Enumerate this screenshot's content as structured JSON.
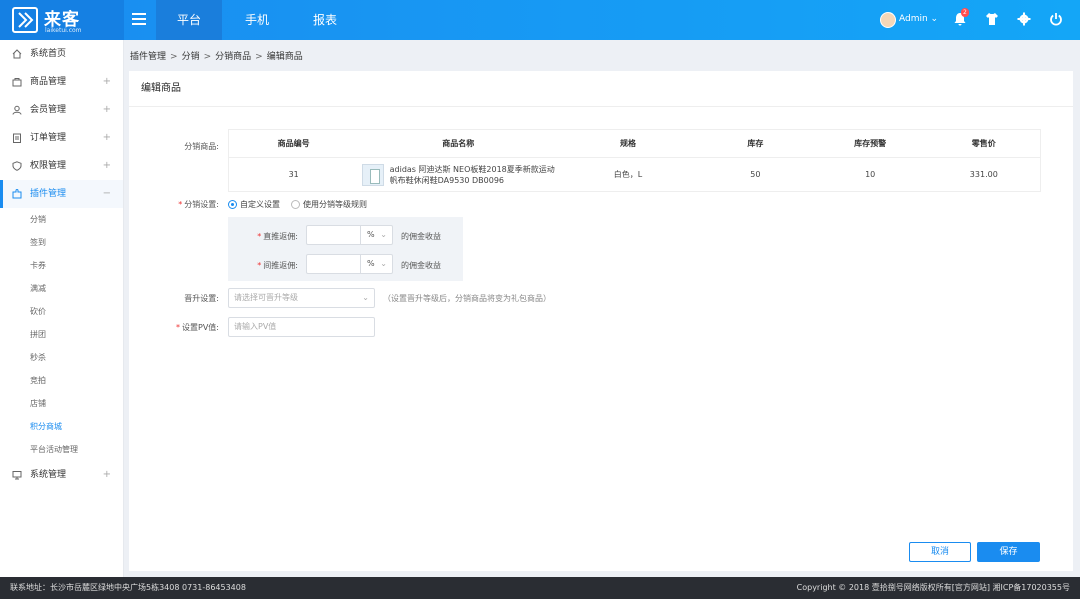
{
  "logo": {
    "name": "来客",
    "sub": "laiketui.com"
  },
  "nav": {
    "tabs": [
      {
        "label": "平台"
      },
      {
        "label": "手机"
      },
      {
        "label": "报表"
      }
    ]
  },
  "user": {
    "name": "Admin ⌄",
    "notif_count": "2"
  },
  "sidebar": {
    "items": [
      {
        "label": "系统首页"
      },
      {
        "label": "商品管理"
      },
      {
        "label": "会员管理"
      },
      {
        "label": "订单管理"
      },
      {
        "label": "权限管理"
      },
      {
        "label": "插件管理"
      }
    ],
    "plugin_sub": [
      {
        "label": "分销"
      },
      {
        "label": "签到"
      },
      {
        "label": "卡券"
      },
      {
        "label": "满减"
      },
      {
        "label": "砍价"
      },
      {
        "label": "拼团"
      },
      {
        "label": "秒杀"
      },
      {
        "label": "竞拍"
      },
      {
        "label": "店铺"
      },
      {
        "label": "积分商城"
      },
      {
        "label": "平台活动管理"
      }
    ],
    "last": {
      "label": "系统管理"
    },
    "plus": "+",
    "minus": "−"
  },
  "breadcrumb": [
    "插件管理",
    "分销",
    "分销商品",
    "编辑商品"
  ],
  "breadcrumb_sep": ">",
  "panel": {
    "title": "编辑商品"
  },
  "form": {
    "product_label": "分销商品:",
    "table": {
      "headers": [
        "商品编号",
        "商品名称",
        "规格",
        "库存",
        "库存预警",
        "零售价"
      ],
      "row": {
        "id": "31",
        "name1": "adidas 阿迪达斯 NEO板鞋2018夏季新款运动",
        "name2": "帆布鞋休闲鞋DA9530 DB0096",
        "spec": "白色，L",
        "stock": "50",
        "warn": "10",
        "price": "331.00"
      }
    },
    "dist_label": "分销设置:",
    "opt_custom": "自定义设置",
    "opt_level": "使用分销等级规则",
    "direct_label": "直推返佣:",
    "indirect_label": "间推返佣:",
    "pct": "%",
    "caret": "⌄",
    "commission_suffix": "的佣金收益",
    "promo_label": "晋升设置:",
    "promo_placeholder": "请选择可晋升等级",
    "promo_note": "（设置晋升等级后，分销商品将变为礼包商品）",
    "pv_label": "设置PV值:",
    "pv_placeholder": "请输入PV值",
    "req": "*"
  },
  "buttons": {
    "cancel": "取消",
    "save": "保存"
  },
  "footer": {
    "left": "联系地址：长沙市岳麓区绿地中央广场5栋3408    0731-86453408",
    "right": "Copyright © 2018 壹拾捌号网络版权所有[官方网站]  湘ICP备17020355号"
  }
}
